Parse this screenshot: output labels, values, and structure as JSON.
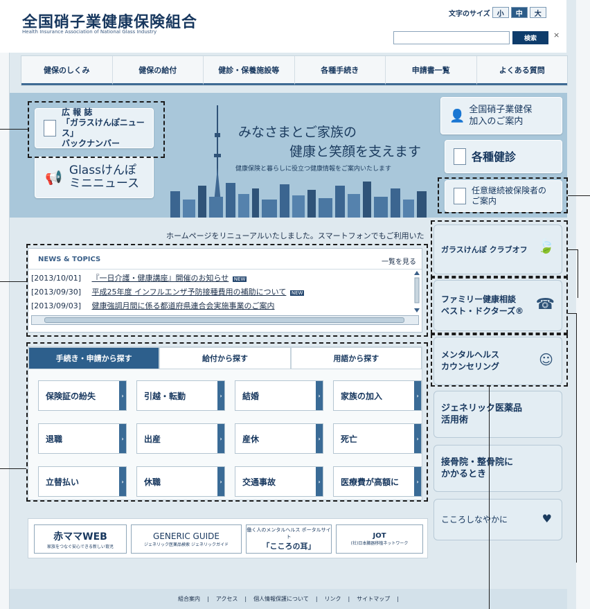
{
  "header": {
    "title": "全国硝子業健康保険組合",
    "subtitle": "Health Insurance Association of National Glass Industry",
    "font_size_label": "文字のサイズ",
    "font_sizes": [
      "小",
      "中",
      "大"
    ],
    "search_button": "検索",
    "search_clear": "×"
  },
  "nav": [
    "健保のしくみ",
    "健保の給付",
    "健診・保養施設等",
    "各種手続き",
    "申請書一覧",
    "よくある質問"
  ],
  "hero": {
    "left_tiles": [
      {
        "line1": "広 報 誌",
        "line2": "「ガラスけんぽニュース」",
        "line3": "バックナンバー"
      },
      {
        "line1": "Glassけんぽ",
        "line2": "ミニニュース"
      }
    ],
    "headline_1": "みなさまとご家族の",
    "headline_2": "健康と笑顔を支えます",
    "tagline": "健康保険と暮らしに役立つ健康情報をご案内いたします",
    "right_tiles": [
      {
        "line1": "全国硝子業健保",
        "line2": "加入のご案内"
      },
      {
        "line1": "各種健診"
      },
      {
        "line1": "任意継続被保険者の",
        "line2": "ご案内"
      }
    ]
  },
  "announcement": "ホームページをリニューアルいたしました。スマートフォンでもご利用いた",
  "news": {
    "title": "NEWS & TOPICS",
    "more_link": "一覧を見る",
    "items": [
      {
        "date": "[2013/10/01]",
        "text": "『一日介護・健康講座』開催のお知らせ",
        "badge": "NEW"
      },
      {
        "date": "[2013/09/30]",
        "text": "平成25年度 インフルエンザ予防接種費用の補助について",
        "badge": "NEW"
      },
      {
        "date": "[2013/09/03]",
        "text": "健康強調月間に係る都道府県連合会実施事業のご案内",
        "badge": ""
      }
    ]
  },
  "search_tabs": {
    "tabs": [
      "手続き・申請から探す",
      "給付から探す",
      "用語から探す"
    ],
    "active_index": 0,
    "items": [
      "保険証の紛失",
      "引越・転勤",
      "結婚",
      "家族の加入",
      "退職",
      "出産",
      "産休",
      "死亡",
      "立替払い",
      "休職",
      "交通事故",
      "医療費が高額に"
    ]
  },
  "side_links": [
    {
      "line1": "ガラスけんぽ クラブオフ"
    },
    {
      "line1": "ファミリー健康相談",
      "line2": "ベスト・ドクターズ®"
    },
    {
      "line1": "メンタルヘルス",
      "line2": "カウンセリング"
    },
    {
      "line1": "ジェネリック医薬品",
      "line2": "活用術"
    },
    {
      "line1": "接骨院・整骨院に",
      "line2": "かかるとき"
    },
    {
      "line1": "こころしなやかに"
    }
  ],
  "banners": [
    {
      "title": "赤ママWEB",
      "sub": "家族をつなぐ安心できる新しい育児"
    },
    {
      "title": "GENERIC GUIDE",
      "sub": "ジェネリック医薬品検索 ジェネリックガイド"
    },
    {
      "title": "働く人のメンタルヘルス ポータルサイト",
      "sub": "「こころの耳」"
    },
    {
      "title": "JOT",
      "sub": "(社)日本臓器移植ネットワーク"
    }
  ],
  "footer": [
    "組合案内",
    "アクセス",
    "個人情報保護について",
    "リンク",
    "サイトマップ"
  ],
  "footer_separator": "|"
}
